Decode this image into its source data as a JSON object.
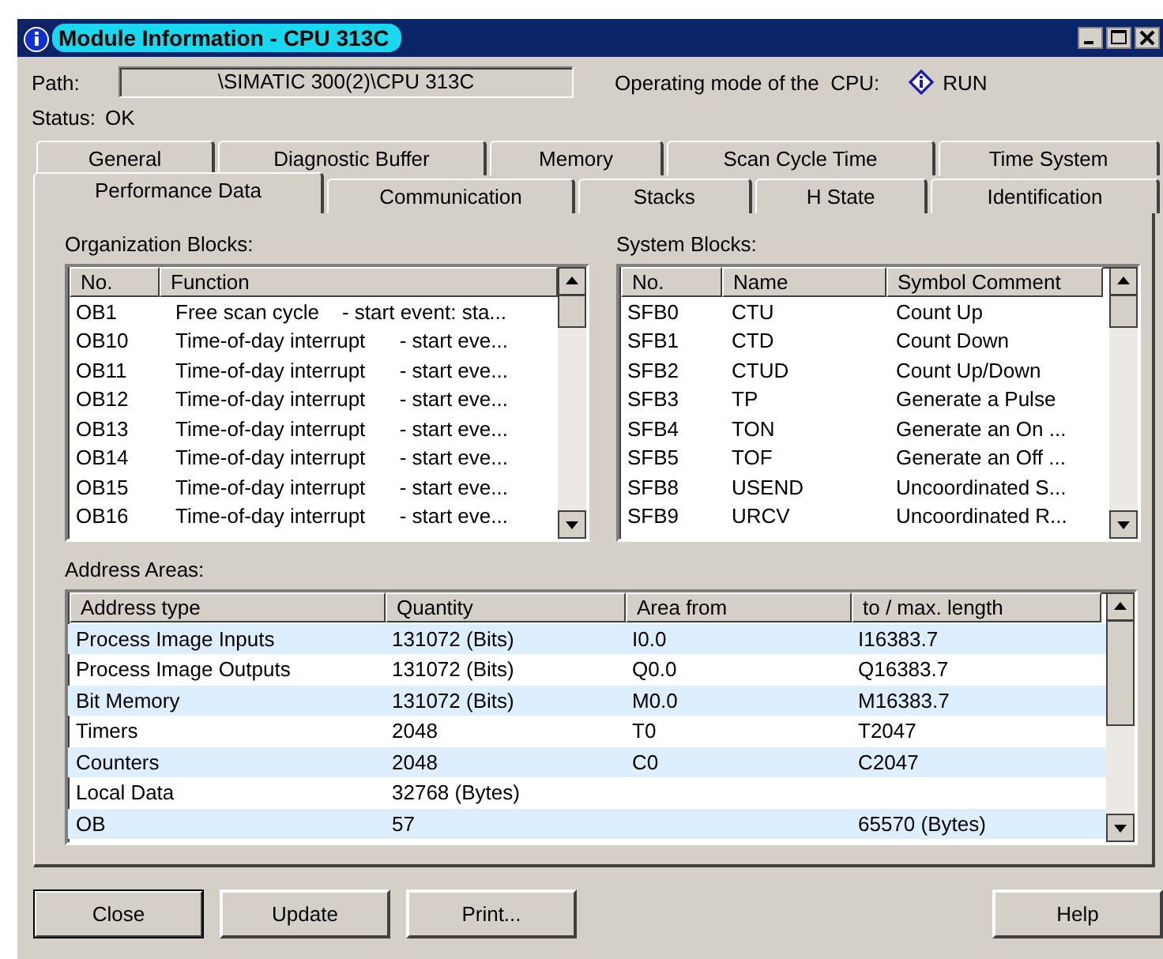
{
  "window": {
    "title": "Module Information - CPU 313C"
  },
  "path": {
    "label": "Path:",
    "value": "\\SIMATIC 300(2)\\CPU 313C"
  },
  "operating_mode": {
    "label": "Operating mode of the  CPU:",
    "value": "RUN"
  },
  "status": {
    "label": "Status:",
    "value": "OK"
  },
  "tab_rows": [
    [
      {
        "label": "General",
        "selected": false
      },
      {
        "label": "Diagnostic Buffer",
        "selected": false
      },
      {
        "label": "Memory",
        "selected": false
      },
      {
        "label": "Scan Cycle Time",
        "selected": false
      },
      {
        "label": "Time System",
        "selected": false
      }
    ],
    [
      {
        "label": "Performance Data",
        "selected": true
      },
      {
        "label": "Communication",
        "selected": false
      },
      {
        "label": "Stacks",
        "selected": false
      },
      {
        "label": "H State",
        "selected": false
      },
      {
        "label": "Identification",
        "selected": false
      }
    ]
  ],
  "organization_blocks": {
    "label": "Organization Blocks:",
    "columns": [
      "No.",
      "Function"
    ],
    "rows": [
      [
        "OB1",
        "Free scan cycle    - start event: sta..."
      ],
      [
        "OB10",
        "Time-of-day interrupt      - start eve..."
      ],
      [
        "OB11",
        "Time-of-day interrupt      - start eve..."
      ],
      [
        "OB12",
        "Time-of-day interrupt      - start eve..."
      ],
      [
        "OB13",
        "Time-of-day interrupt      - start eve..."
      ],
      [
        "OB14",
        "Time-of-day interrupt      - start eve..."
      ],
      [
        "OB15",
        "Time-of-day interrupt      - start eve..."
      ],
      [
        "OB16",
        "Time-of-day interrupt      - start eve..."
      ]
    ]
  },
  "system_blocks": {
    "label": "System Blocks:",
    "columns": [
      "No.",
      "Name",
      "Symbol Comment"
    ],
    "rows": [
      [
        "SFB0",
        "CTU",
        "Count Up"
      ],
      [
        "SFB1",
        "CTD",
        "Count Down"
      ],
      [
        "SFB2",
        "CTUD",
        "Count Up/Down"
      ],
      [
        "SFB3",
        "TP",
        "Generate a Pulse"
      ],
      [
        "SFB4",
        "TON",
        "Generate an On ..."
      ],
      [
        "SFB5",
        "TOF",
        "Generate an Off ..."
      ],
      [
        "SFB8",
        "USEND",
        "Uncoordinated S..."
      ],
      [
        "SFB9",
        "URCV",
        "Uncoordinated R..."
      ]
    ]
  },
  "address_areas": {
    "label": "Address Areas:",
    "columns": [
      "Address type",
      "Quantity",
      "Area from",
      "to / max. length"
    ],
    "rows": [
      [
        "Process Image Inputs",
        "131072 (Bits)",
        "I0.0",
        "I16383.7"
      ],
      [
        "Process Image Outputs",
        "131072 (Bits)",
        "Q0.0",
        "Q16383.7"
      ],
      [
        "Bit Memory",
        "131072 (Bits)",
        "M0.0",
        "M16383.7"
      ],
      [
        "Timers",
        "2048",
        "T0",
        "T2047"
      ],
      [
        "Counters",
        "2048",
        "C0",
        "C2047"
      ],
      [
        "Local Data",
        "32768 (Bytes)",
        "",
        ""
      ],
      [
        "OB",
        "57",
        "",
        "65570 (Bytes)"
      ]
    ]
  },
  "buttons": [
    {
      "label": "Close",
      "default": true
    },
    {
      "label": "Update",
      "default": false
    },
    {
      "label": "Print...",
      "default": false
    },
    {
      "label": "Help",
      "default": false
    }
  ]
}
